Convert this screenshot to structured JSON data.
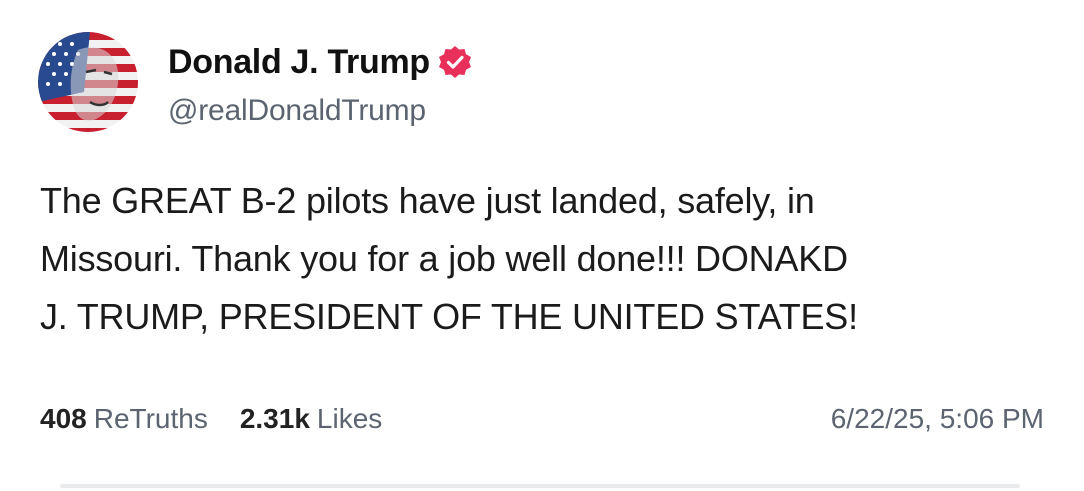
{
  "post": {
    "author": {
      "display_name": "Donald J. Trump",
      "handle": "@realDonaldTrump",
      "avatar_icon": "flag-portrait-avatar",
      "verified_icon": "verified-badge-icon",
      "verified_color": "#e8305a"
    },
    "text_lines": [
      "The GREAT B-2 pilots have just landed, safely, in",
      "Missouri. Thank you for a job well done!!! DONAKD",
      "J. TRUMP, PRESIDENT OF THE UNITED STATES!"
    ],
    "stats": {
      "retruths_count": "408",
      "retruths_label": "ReTruths",
      "likes_count": "2.31k",
      "likes_label": "Likes"
    },
    "timestamp": "6/22/25, 5:06 PM"
  }
}
